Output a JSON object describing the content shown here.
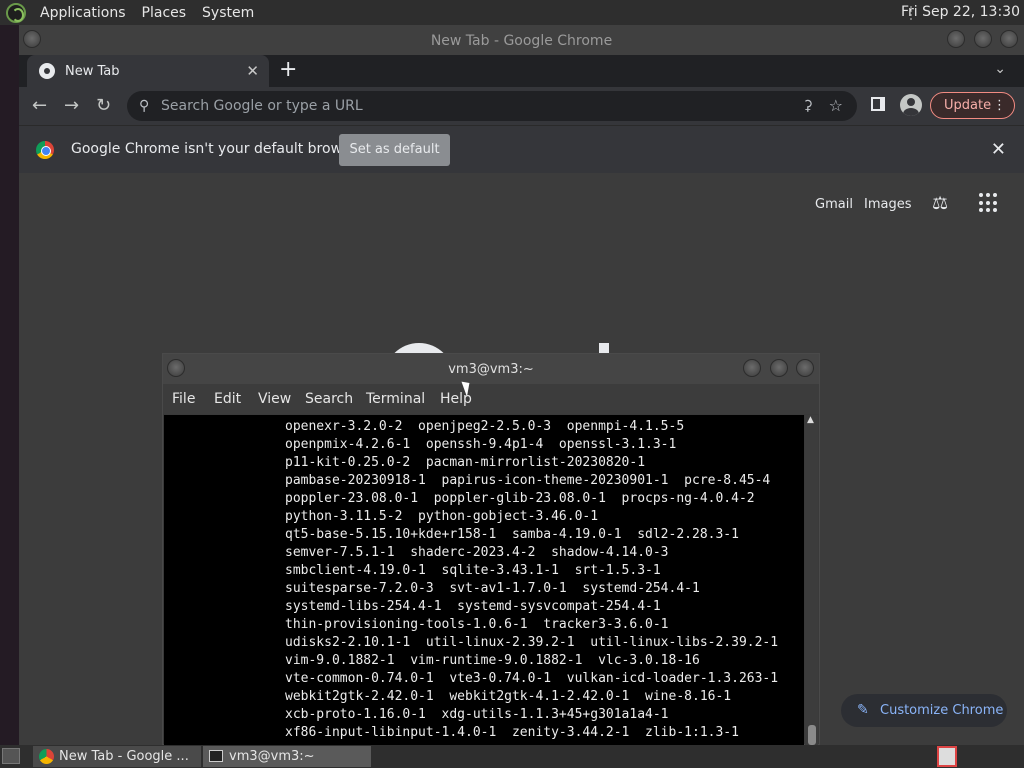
{
  "top_panel": {
    "menus": [
      "Applications",
      "Places",
      "System"
    ],
    "clock": "Fri Sep 22, 13:30"
  },
  "chrome": {
    "window_title": "New Tab - Google Chrome",
    "tab_title": "New Tab",
    "tab_close": "✕",
    "new_tab": "+",
    "tab_search": "⌄",
    "omnibox_placeholder": "Search Google or type a URL",
    "update_label": "Update",
    "infobar_message": "Google Chrome isn't your default browser",
    "set_default_label": "Set as default",
    "links": {
      "gmail": "Gmail",
      "images": "Images"
    },
    "customize_label": "Customize Chrome"
  },
  "terminal": {
    "title": "vm3@vm3:~",
    "menus": [
      "File",
      "Edit",
      "View",
      "Search",
      "Terminal",
      "Help"
    ],
    "lines": [
      "openexr-3.2.0-2  openjpeg2-2.5.0-3  openmpi-4.1.5-5",
      "openpmix-4.2.6-1  openssh-9.4p1-4  openssl-3.1.3-1",
      "p11-kit-0.25.0-2  pacman-mirrorlist-20230820-1",
      "pambase-20230918-1  papirus-icon-theme-20230901-1  pcre-8.45-4",
      "poppler-23.08.0-1  poppler-glib-23.08.0-1  procps-ng-4.0.4-2",
      "python-3.11.5-2  python-gobject-3.46.0-1",
      "qt5-base-5.15.10+kde+r158-1  samba-4.19.0-1  sdl2-2.28.3-1",
      "semver-7.5.1-1  shaderc-2023.4-2  shadow-4.14.0-3",
      "smbclient-4.19.0-1  sqlite-3.43.1-1  srt-1.5.3-1",
      "suitesparse-7.2.0-3  svt-av1-1.7.0-1  systemd-254.4-1",
      "systemd-libs-254.4-1  systemd-sysvcompat-254.4-1",
      "thin-provisioning-tools-1.0.6-1  tracker3-3.6.0-1",
      "udisks2-2.10.1-1  util-linux-2.39.2-1  util-linux-libs-2.39.2-1",
      "vim-9.0.1882-1  vim-runtime-9.0.1882-1  vlc-3.0.18-16",
      "vte-common-0.74.0-1  vte3-0.74.0-1  vulkan-icd-loader-1.3.263-1",
      "webkit2gtk-2.42.0-1  webkit2gtk-4.1-2.42.0-1  wine-8.16-1",
      "xcb-proto-1.16.0-1  xdg-utils-1.1.3+45+g301a1a4-1",
      "xf86-input-libinput-1.4.0-1  zenity-3.44.2-1  zlib-1:1.3-1"
    ]
  },
  "taskbar": {
    "items": [
      {
        "label": "New Tab - Google ...",
        "icon": "chrome-icon"
      },
      {
        "label": "vm3@vm3:~",
        "icon": "terminal-icon"
      }
    ]
  },
  "colors": {
    "accent_blue": "#8ab4f8",
    "update_border": "#f28b82"
  }
}
